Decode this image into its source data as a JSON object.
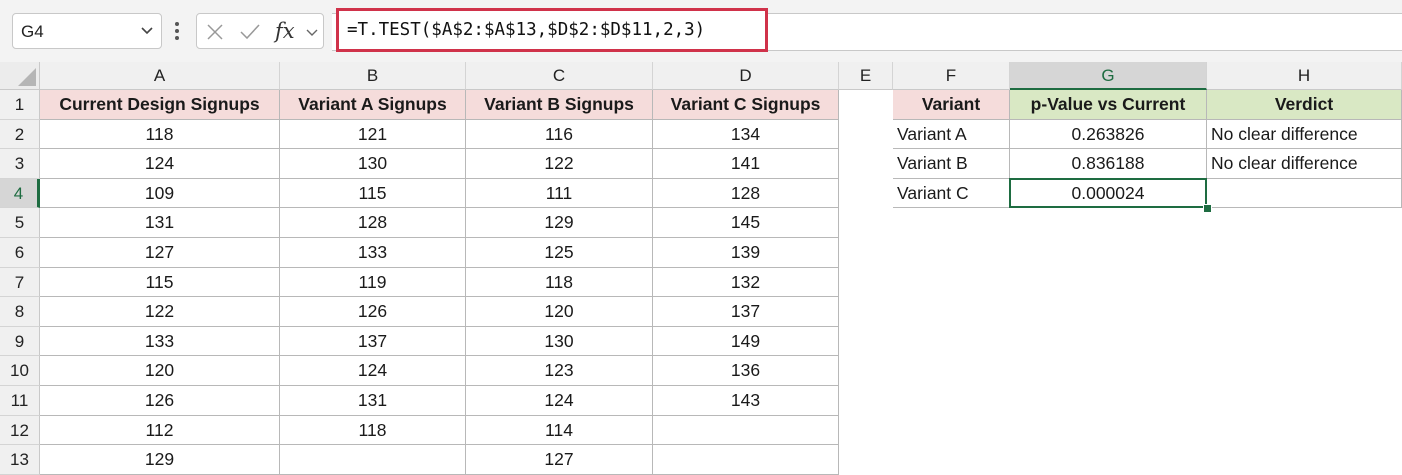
{
  "formula_bar": {
    "name_box": "G4",
    "fx_label": "fx",
    "formula": "=T.TEST($A$2:$A$13,$D$2:$D$11,2,3)"
  },
  "columns": [
    "A",
    "B",
    "C",
    "D",
    "E",
    "F",
    "G",
    "H"
  ],
  "rows": [
    "1",
    "2",
    "3",
    "4",
    "5",
    "6",
    "7",
    "8",
    "9",
    "10",
    "11",
    "12",
    "13"
  ],
  "active_cell": {
    "column": "G",
    "row": "4"
  },
  "left_table": {
    "headers": [
      "Current Design Signups",
      "Variant A Signups",
      "Variant B Signups",
      "Variant C Signups"
    ],
    "rows": [
      [
        "118",
        "121",
        "116",
        "134"
      ],
      [
        "124",
        "130",
        "122",
        "141"
      ],
      [
        "109",
        "115",
        "111",
        "128"
      ],
      [
        "131",
        "128",
        "129",
        "145"
      ],
      [
        "127",
        "133",
        "125",
        "139"
      ],
      [
        "115",
        "119",
        "118",
        "132"
      ],
      [
        "122",
        "126",
        "120",
        "137"
      ],
      [
        "133",
        "137",
        "130",
        "149"
      ],
      [
        "120",
        "124",
        "123",
        "136"
      ],
      [
        "126",
        "131",
        "124",
        "143"
      ],
      [
        "112",
        "118",
        "114",
        ""
      ],
      [
        "129",
        "",
        "127",
        ""
      ]
    ]
  },
  "right_table": {
    "headers": [
      "Variant",
      "p-Value vs Current",
      "Verdict"
    ],
    "rows": [
      [
        "Variant A",
        "0.263826",
        "No clear difference"
      ],
      [
        "Variant B",
        "0.836188",
        "No clear difference"
      ],
      [
        "Variant C",
        "0.000024",
        ""
      ]
    ]
  },
  "colors": {
    "accent_green": "#1e6c41",
    "highlight_red": "#d0324a",
    "header_pink": "#f5dcdb",
    "header_green": "#d9e8c4"
  }
}
